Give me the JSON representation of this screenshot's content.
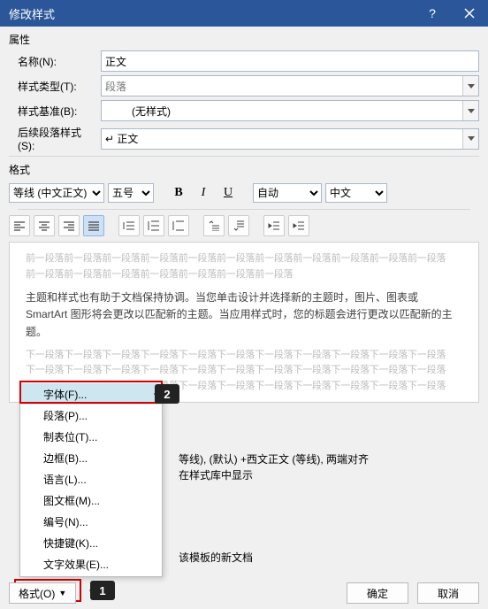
{
  "title": "修改样式",
  "section_properties": "属性",
  "section_format": "格式",
  "labels": {
    "name": "名称(N):",
    "styleType": "样式类型(T):",
    "styleBase": "样式基准(B):",
    "nextStyle": "后续段落样式(S):"
  },
  "fields": {
    "name_value": "正文",
    "styleType_value": "段落",
    "styleBase_value": "(无样式)",
    "nextStyle_value": "↵ 正文"
  },
  "toolbar": {
    "font": "等线 (中文正文)",
    "size": "五号",
    "colorAuto": "自动",
    "script": "中文"
  },
  "preview": {
    "faint_prev": "前一段落前一段落前一段落前一段落前一段落前一段落前一段落前一段落前一段落前一段落前一段落",
    "faint_prev2": "前一段落前一段落前一段落前一段落前一段落前一段落前一段落",
    "body": "主题和样式也有助于文档保持协调。当您单击设计并选择新的主题时，图片、图表或 SmartArt 图形将会更改以匹配新的主题。当应用样式时，您的标题会进行更改以匹配新的主题。",
    "faint_next": "下一段落下一段落下一段落下一段落下一段落下一段落下一段落下一段落下一段落下一段落下一段落",
    "faint_next2": "下一段落下一段落下一段落下一段落下一段落下一段落下一段落下一段落下一段落下一段落下一段落",
    "faint_next3": "下一段落下一段落下一段落下一段落下一段落下一段落下一段落下一段落下一段落下一段落下一段落"
  },
  "desc_line1": "等线), (默认) +西文正文 (等线), 两端对齐",
  "desc_line2": "在样式库中显示",
  "radio_template_text": "该模板的新文档",
  "menu": {
    "items": [
      {
        "label": "字体(F)...",
        "selected": true
      },
      {
        "label": "段落(P)..."
      },
      {
        "label": "制表位(T)..."
      },
      {
        "label": "边框(B)..."
      },
      {
        "label": "语言(L)..."
      },
      {
        "label": "图文框(M)..."
      },
      {
        "label": "编号(N)..."
      },
      {
        "label": "快捷键(K)..."
      },
      {
        "label": "文字效果(E)..."
      }
    ]
  },
  "footer": {
    "format_btn": "格式(O)",
    "ok": "确定",
    "cancel": "取消"
  },
  "callouts": {
    "c1": "1",
    "c2": "2"
  }
}
